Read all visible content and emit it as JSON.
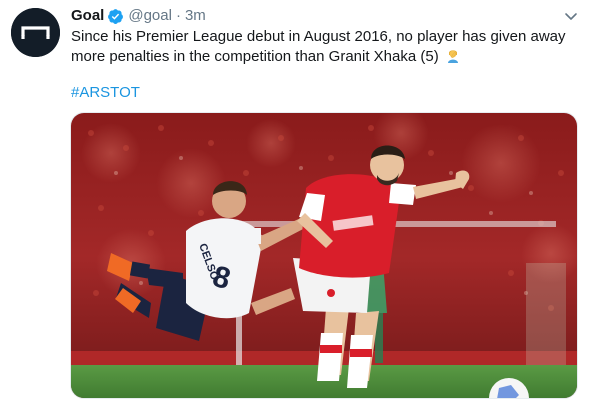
{
  "author": {
    "name": "Goal",
    "handle": "@goal",
    "separator": "·",
    "time": "3m",
    "verified": true,
    "avatar_icon": "goal-logo-icon",
    "avatar_color": "#131d28"
  },
  "tweet": {
    "text": "Since his Premier League debut in August 2016, no player has given away more penalties in the competition than Granit Xhaka (5)",
    "emoji": "person-facepalming",
    "hashtag": "#ARSTOT"
  },
  "media": {
    "type": "photo",
    "shirt_number": "8",
    "shirt_name": "CELSO"
  },
  "colors": {
    "text": "#14171a",
    "secondary": "#657786",
    "link": "#1b95e0",
    "verified": "#1da1f2",
    "arsenal_red": "#d91e2a",
    "pitch_green": "#4f8a3a"
  }
}
